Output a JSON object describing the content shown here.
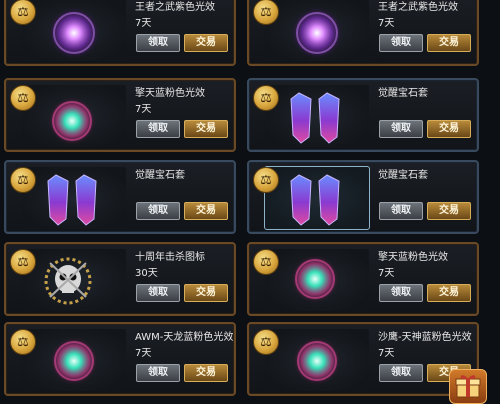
{
  "cards": [
    {
      "name": "王者之武紫色光效",
      "duration": "7天",
      "claim": "领取",
      "trade": "交易",
      "item_icon": "purple-glow-orb-icon",
      "frame": "gold"
    },
    {
      "name": "王者之武紫色光效",
      "duration": "7天",
      "claim": "领取",
      "trade": "交易",
      "item_icon": "purple-glow-orb-icon",
      "frame": "gold"
    },
    {
      "name": "擎天蓝粉色光效",
      "duration": "7天",
      "claim": "领取",
      "trade": "交易",
      "item_icon": "teal-pink-glow-orb-icon",
      "frame": "gold"
    },
    {
      "name": "觉醒宝石套",
      "duration": "",
      "claim": "领取",
      "trade": "交易",
      "item_icon": "gem-pair-icon",
      "frame": "blue"
    },
    {
      "name": "觉醒宝石套",
      "duration": "",
      "claim": "领取",
      "trade": "交易",
      "item_icon": "gem-pair-icon",
      "frame": "blue"
    },
    {
      "name": "觉醒宝石套",
      "duration": "",
      "claim": "领取",
      "trade": "交易",
      "item_icon": "gem-pair-icon",
      "frame": "blue"
    },
    {
      "name": "十周年击杀图标",
      "duration": "30天",
      "claim": "领取",
      "trade": "交易",
      "item_icon": "skull-emblem-icon",
      "frame": "gold"
    },
    {
      "name": "擎天蓝粉色光效",
      "duration": "7天",
      "claim": "领取",
      "trade": "交易",
      "item_icon": "teal-pink-glow-orb-icon",
      "frame": "gold"
    },
    {
      "name": "AWM-天龙蓝粉色光效",
      "duration": "7天",
      "claim": "领取",
      "trade": "交易",
      "item_icon": "teal-pink-glow-orb-icon",
      "frame": "gold"
    },
    {
      "name": "沙鹰-天神蓝粉色光效",
      "duration": "7天",
      "claim": "领取",
      "trade": "交易",
      "item_icon": "teal-pink-glow-orb-icon",
      "frame": "gold"
    }
  ],
  "badge_glyph": "⚖",
  "gift_button_icon": "gift-box-icon",
  "colors": {
    "gold_frame": "#6a4a26",
    "blue_frame": "#3a4a5e",
    "trade_button": "#b88a3a",
    "claim_button": "#5a5f66"
  }
}
